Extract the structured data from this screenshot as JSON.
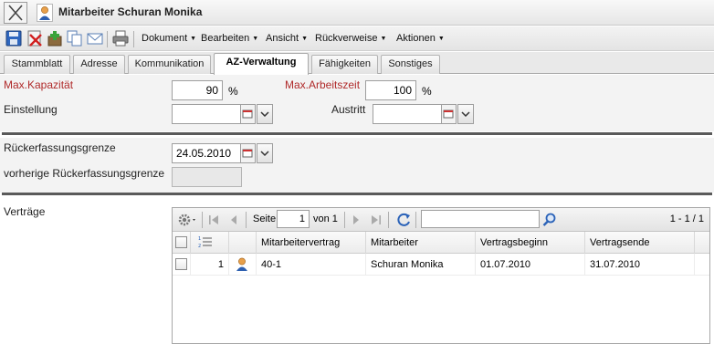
{
  "window": {
    "title": "Mitarbeiter Schuran Monika"
  },
  "toolbar": {
    "icons": [
      "save-icon",
      "delete-icon",
      "add-icon",
      "copy-icon",
      "mail-icon",
      "print-icon"
    ],
    "menus": [
      "Dokument",
      "Bearbeiten",
      "Ansicht",
      "Rückverweise",
      "Aktionen"
    ]
  },
  "tabs": [
    "Stammblatt",
    "Adresse",
    "Kommunikation",
    "AZ-Verwaltung",
    "Fähigkeiten",
    "Sonstiges"
  ],
  "active_tab": "AZ-Verwaltung",
  "form": {
    "max_kapazitaet": {
      "label": "Max.Kapazität",
      "value": "90",
      "unit": "%"
    },
    "max_arbeitszeit": {
      "label": "Max.Arbeitszeit",
      "value": "100",
      "unit": "%"
    },
    "einstellung": {
      "label": "Einstellung",
      "value": ""
    },
    "austritt": {
      "label": "Austritt",
      "value": ""
    },
    "rueckerfassungsgrenze": {
      "label": "Rückerfassungsgrenze",
      "value": "24.05.2010"
    },
    "vorherige": {
      "label": "vorherige Rückerfassungsgrenze",
      "value": ""
    },
    "vertraege_label": "Verträge"
  },
  "grid": {
    "pager": {
      "page_label": "Seite",
      "page": "1",
      "of_label": "von 1",
      "range": "1 - 1 / 1"
    },
    "search": {
      "value": ""
    },
    "columns": [
      "Mitarbeitervertrag",
      "Mitarbeiter",
      "Vertragsbeginn",
      "Vertragsende"
    ],
    "rows": [
      {
        "num": "1",
        "vertrag": "40-1",
        "mitarbeiter": "Schuran Monika",
        "beginn": "01.07.2010",
        "ende": "31.07.2010"
      }
    ]
  },
  "colors": {
    "required_label": "#b02a2a",
    "accent_blue": "#2a62b8",
    "divider": "#5a5a5a"
  }
}
